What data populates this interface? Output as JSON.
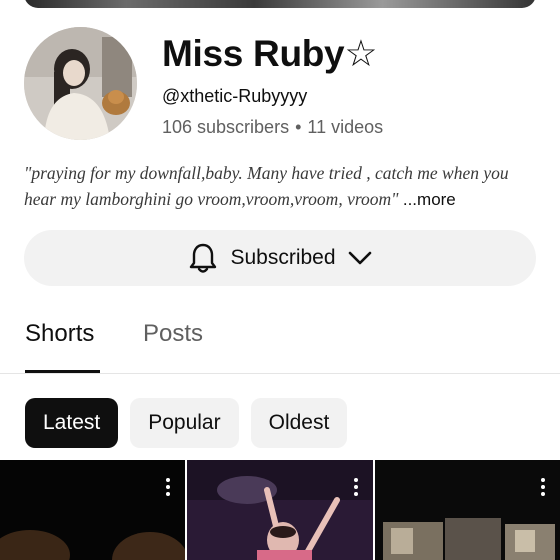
{
  "channel": {
    "name": "Miss Ruby☆",
    "handle": "@xthetic-Rubyyyy",
    "subscribers": "106 subscribers",
    "separator": "•",
    "videos": "11 videos",
    "description": "\"praying for my downfall,baby. Many have tried , catch me when you hear my lamborghini go vroom,vroom,vroom, vroom\"",
    "more_label": "...more"
  },
  "subscribe_button": {
    "label": "Subscribed",
    "icon": "bell-icon",
    "chevron": "chevron-down-icon"
  },
  "tabs": [
    {
      "label": "Shorts",
      "active": true
    },
    {
      "label": "Posts",
      "active": false
    }
  ],
  "filters": [
    {
      "label": "Latest",
      "selected": true
    },
    {
      "label": "Popular",
      "selected": false
    },
    {
      "label": "Oldest",
      "selected": false
    }
  ],
  "shorts": [
    {
      "thumbnail": "dark-portrait",
      "menu_icon": "more-vert-icon"
    },
    {
      "thumbnail": "concert-performer",
      "menu_icon": "more-vert-icon"
    },
    {
      "thumbnail": "photo-collage",
      "menu_icon": "more-vert-icon"
    }
  ],
  "colors": {
    "text_primary": "#0f0f0f",
    "text_secondary": "#606060",
    "chip_bg": "#f2f2f2",
    "chip_selected_bg": "#0f0f0f"
  }
}
